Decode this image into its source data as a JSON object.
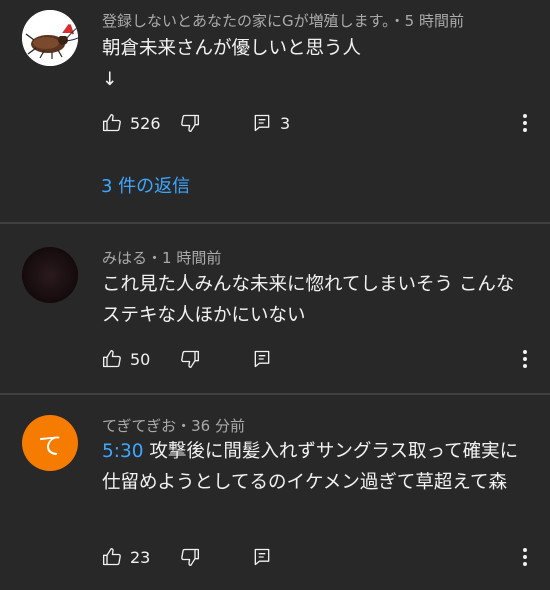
{
  "comments": [
    {
      "author": "登録しないとあなたの家にGが増殖します。",
      "time": "・5 時間前",
      "text": "朝倉未来さんが優しいと思う人\n↓",
      "likes": "526",
      "reply_count": "3",
      "replies_link": "3 件の返信",
      "avatar_icon": "cockroach-santa-avatar"
    },
    {
      "author": "みはる",
      "time": "・1 時間前",
      "text": "これ見た人みんな未来に惚れてしまいそう こんなステキな人ほかにいない",
      "likes": "50",
      "avatar_icon": "dark-avatar"
    },
    {
      "author": "てぎてぎお",
      "time": "・36 分前",
      "timestamp_link": "5:30",
      "text": " 攻撃後に間髪入れずサングラス取って確実に仕留めようとしてるのイケメン過ぎて草超えて森",
      "likes": "23",
      "avatar_letter": "て",
      "avatar_color": "#f57c00"
    }
  ],
  "colors": {
    "background": "#282828",
    "link": "#3ea6ff",
    "secondary_text": "#aaaaaa",
    "divider": "#3f3f3f"
  }
}
